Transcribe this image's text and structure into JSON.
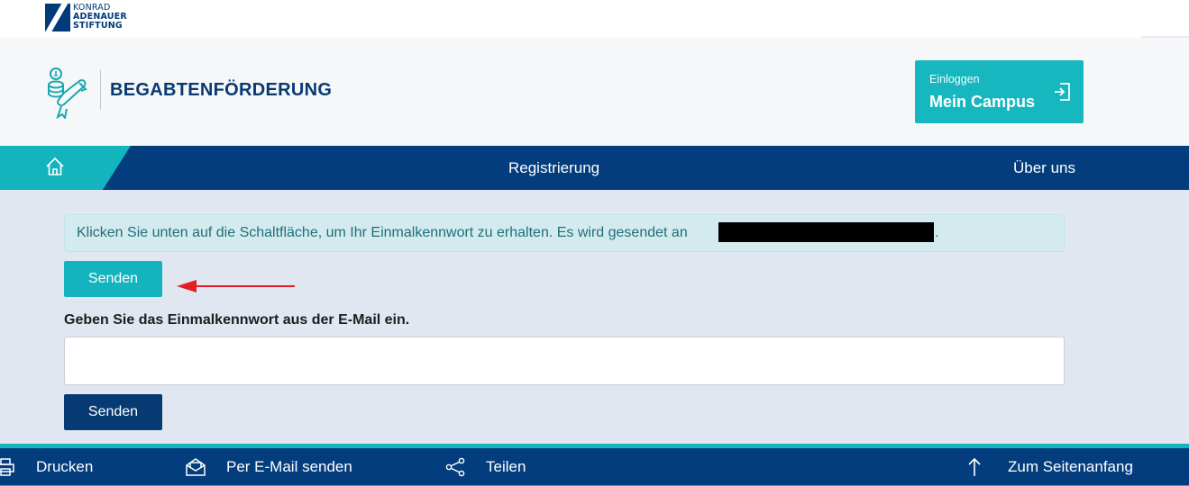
{
  "topbar": {
    "logo_line1": "KONRAD",
    "logo_line2": "ADENAUER",
    "logo_line3": "STIFTUNG"
  },
  "header": {
    "brand_title": "BEGABTENFÖRDERUNG",
    "brand_icon": "scholarship-icon",
    "login": {
      "small_label": "Einloggen",
      "main_label": "Mein Campus",
      "icon": "login-icon"
    }
  },
  "nav": {
    "home_icon": "home-icon",
    "items": [
      {
        "label": "Registrierung"
      },
      {
        "label": "Über uns"
      }
    ]
  },
  "main": {
    "info_message": "Klicken Sie unten auf die Schaltfläche, um Ihr Einmalkennwort zu erhalten. Es wird gesendet an",
    "info_message_end": ".",
    "send_button_1": "Senden",
    "otp_label": "Geben Sie das Einmalkennwort aus der E-Mail ein.",
    "otp_value": "",
    "otp_placeholder": "",
    "send_button_2": "Senden",
    "annotation": "red-arrow-icon"
  },
  "footer": {
    "items": [
      {
        "label": "Drucken",
        "icon": "printer-icon"
      },
      {
        "label": "Per E-Mail senden",
        "icon": "mail-icon"
      },
      {
        "label": "Teilen",
        "icon": "share-icon"
      },
      {
        "label": "Zum Seitenanfang",
        "icon": "arrow-up-icon"
      }
    ]
  },
  "colors": {
    "navy": "#043d7e",
    "teal": "#13b4bd",
    "page_bg": "#e0e7f0",
    "info_bg": "#d3ebef",
    "annotation_red": "#e31e24"
  }
}
